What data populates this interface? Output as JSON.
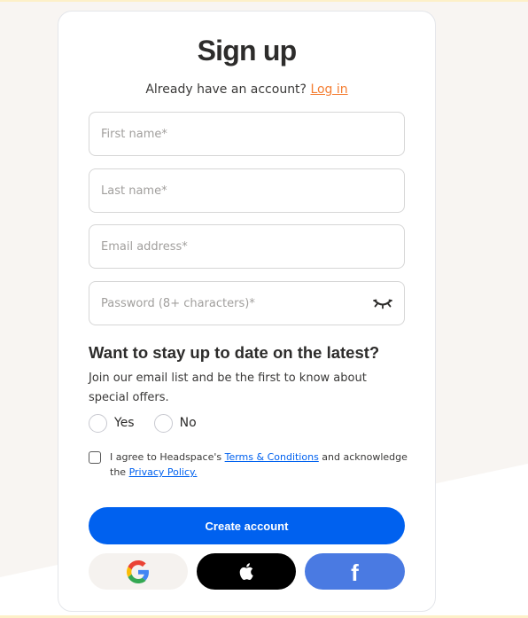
{
  "header": {
    "title": "Sign up",
    "login_prompt": "Already have an account?",
    "login_link": "Log in"
  },
  "form": {
    "first_name": {
      "placeholder": "First name*",
      "value": ""
    },
    "last_name": {
      "placeholder": "Last name*",
      "value": ""
    },
    "email": {
      "placeholder": "Email address*",
      "value": ""
    },
    "password": {
      "placeholder": "Password (8+ characters)*",
      "value": "",
      "toggle_icon": "eye-closed-icon"
    }
  },
  "newsletter": {
    "heading": "Want to stay up to date on the latest?",
    "text": "Join our email list and be the first to know about special offers.",
    "options": [
      {
        "label": "Yes",
        "selected": false
      },
      {
        "label": "No",
        "selected": false
      }
    ]
  },
  "terms": {
    "checked": false,
    "prefix": "I agree to Headspace's ",
    "terms_link": "Terms & Conditions",
    "middle": " and acknowledge the ",
    "privacy_link": "Privacy Policy."
  },
  "actions": {
    "create_account": "Create account",
    "social": [
      {
        "name": "google",
        "icon": "google-icon"
      },
      {
        "name": "apple",
        "icon": "apple-icon"
      },
      {
        "name": "facebook",
        "icon": "facebook-icon",
        "glyph": "f"
      }
    ]
  },
  "colors": {
    "primary": "#0061ef",
    "link_orange": "#f47d31",
    "facebook": "#4a7ae2",
    "apple": "#000000",
    "google_bg": "#f5f2ef",
    "page_bg": "#f8f5f2"
  }
}
